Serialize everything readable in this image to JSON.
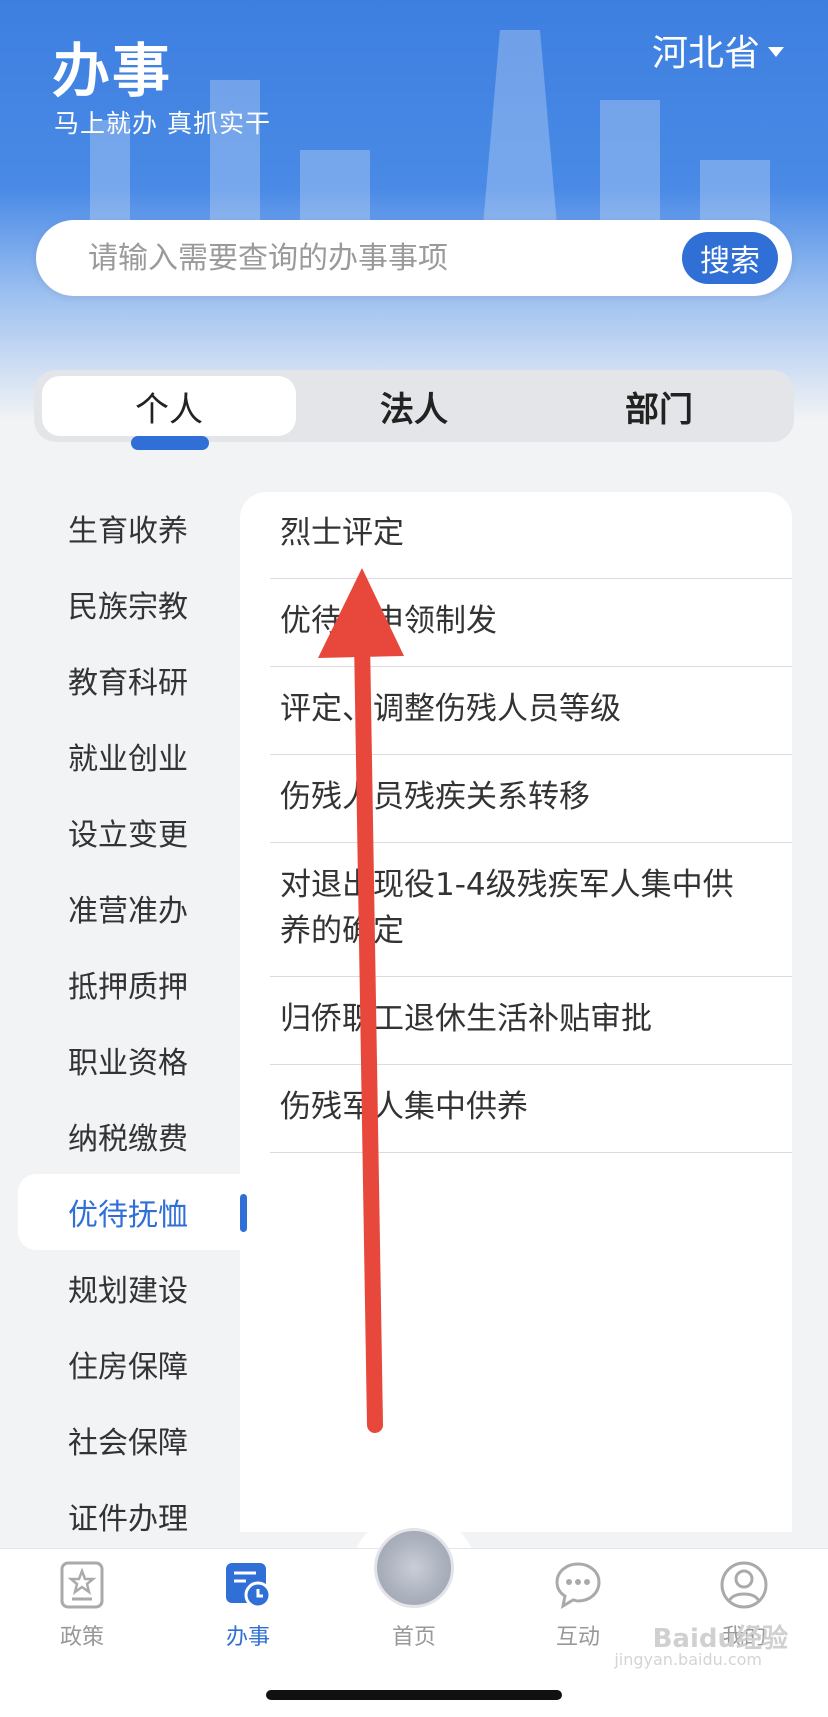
{
  "header": {
    "title": "办事",
    "subtitle": "马上就办  真抓实干",
    "province": "河北省"
  },
  "search": {
    "placeholder": "请输入需要查询的办事事项",
    "button_label": "搜索"
  },
  "tabs": [
    {
      "label": "个人",
      "active": true
    },
    {
      "label": "法人",
      "active": false
    },
    {
      "label": "部门",
      "active": false
    }
  ],
  "sidebar": {
    "items": [
      {
        "label": "生育收养"
      },
      {
        "label": "民族宗教"
      },
      {
        "label": "教育科研"
      },
      {
        "label": "就业创业"
      },
      {
        "label": "设立变更"
      },
      {
        "label": "准营准办"
      },
      {
        "label": "抵押质押"
      },
      {
        "label": "职业资格"
      },
      {
        "label": "纳税缴费"
      },
      {
        "label": "优待抚恤",
        "active": true
      },
      {
        "label": "规划建设"
      },
      {
        "label": "住房保障"
      },
      {
        "label": "社会保障"
      },
      {
        "label": "证件办理"
      }
    ]
  },
  "services": {
    "items": [
      {
        "label": "烈士评定"
      },
      {
        "label": "优待证申领制发"
      },
      {
        "label": "评定、调整伤残人员等级"
      },
      {
        "label": "伤残人员残疾关系转移"
      },
      {
        "label": "对退出现役1-4级残疾军人集中供养的确定"
      },
      {
        "label": "归侨职工退休生活补贴审批"
      },
      {
        "label": "伤残军人集中供养"
      }
    ]
  },
  "bottom_nav": {
    "items": [
      {
        "label": "政策",
        "icon": "policy-icon"
      },
      {
        "label": "办事",
        "icon": "affairs-icon",
        "active": true
      },
      {
        "label": "首页",
        "icon": "home-emblem-icon"
      },
      {
        "label": "互动",
        "icon": "chat-icon"
      },
      {
        "label": "我的",
        "icon": "user-icon"
      }
    ]
  },
  "watermark": {
    "text": "Baidu经验",
    "sub": "jingyan.baidu.com"
  },
  "colors": {
    "accent": "#2f6fd6",
    "annotation_arrow": "#e8483b"
  }
}
